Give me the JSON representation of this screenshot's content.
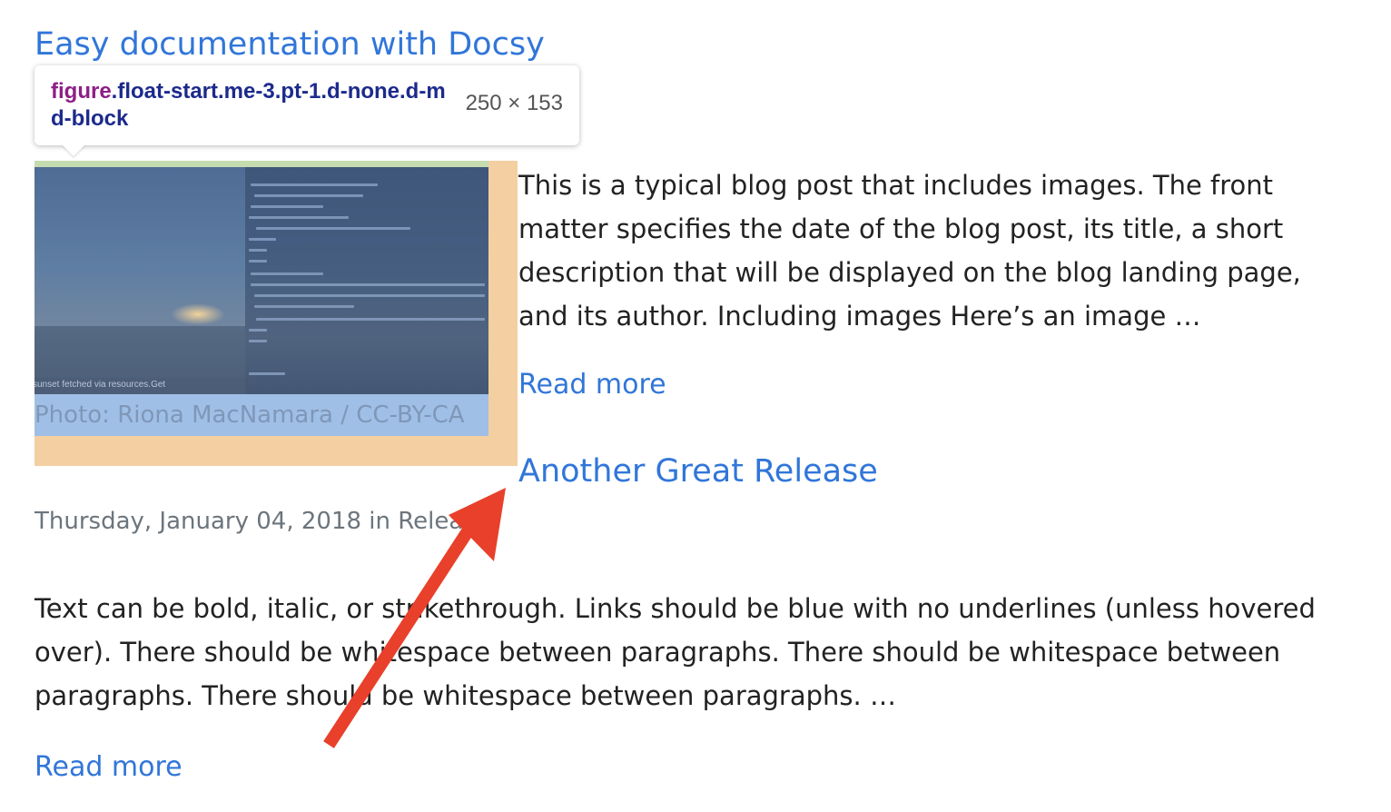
{
  "posts": [
    {
      "title": "Easy documentation with Docsy",
      "excerpt": "This is a typical blog post that includes images. The front matter specifies the date of the blog post, its title, a short description that will be displayed on the blog landing page, and its author. Including images Here’s an image …",
      "read_more": "Read more",
      "figure": {
        "caption": "Photo: Riona MacNamara / CC-BY-CA",
        "image_overlay_text": "sunset fetched via resources.Get"
      }
    },
    {
      "title": "Another Great Release",
      "meta": "Thursday, January 04, 2018 in Relea",
      "excerpt": "Text can be bold, italic, or strikethrough. Links should be blue with no underlines (unless hovered over). There should be whitespace between paragraphs. There should be whitespace between paragraphs. There should be whitespace between paragraphs. …",
      "read_more": "Read more"
    }
  ],
  "devtools_tooltip": {
    "tag": "figure",
    "classes": ".float-start.me-3.pt-1.d-none.d-md-block",
    "dimensions": "250 × 153"
  },
  "annotation": {
    "type": "red-arrow",
    "color": "#e8402a"
  },
  "colors": {
    "link": "#3176d9",
    "highlight_margin": "#f3cfa1",
    "highlight_padding": "#c4dcb0",
    "highlight_content": "#9fbfe6"
  }
}
